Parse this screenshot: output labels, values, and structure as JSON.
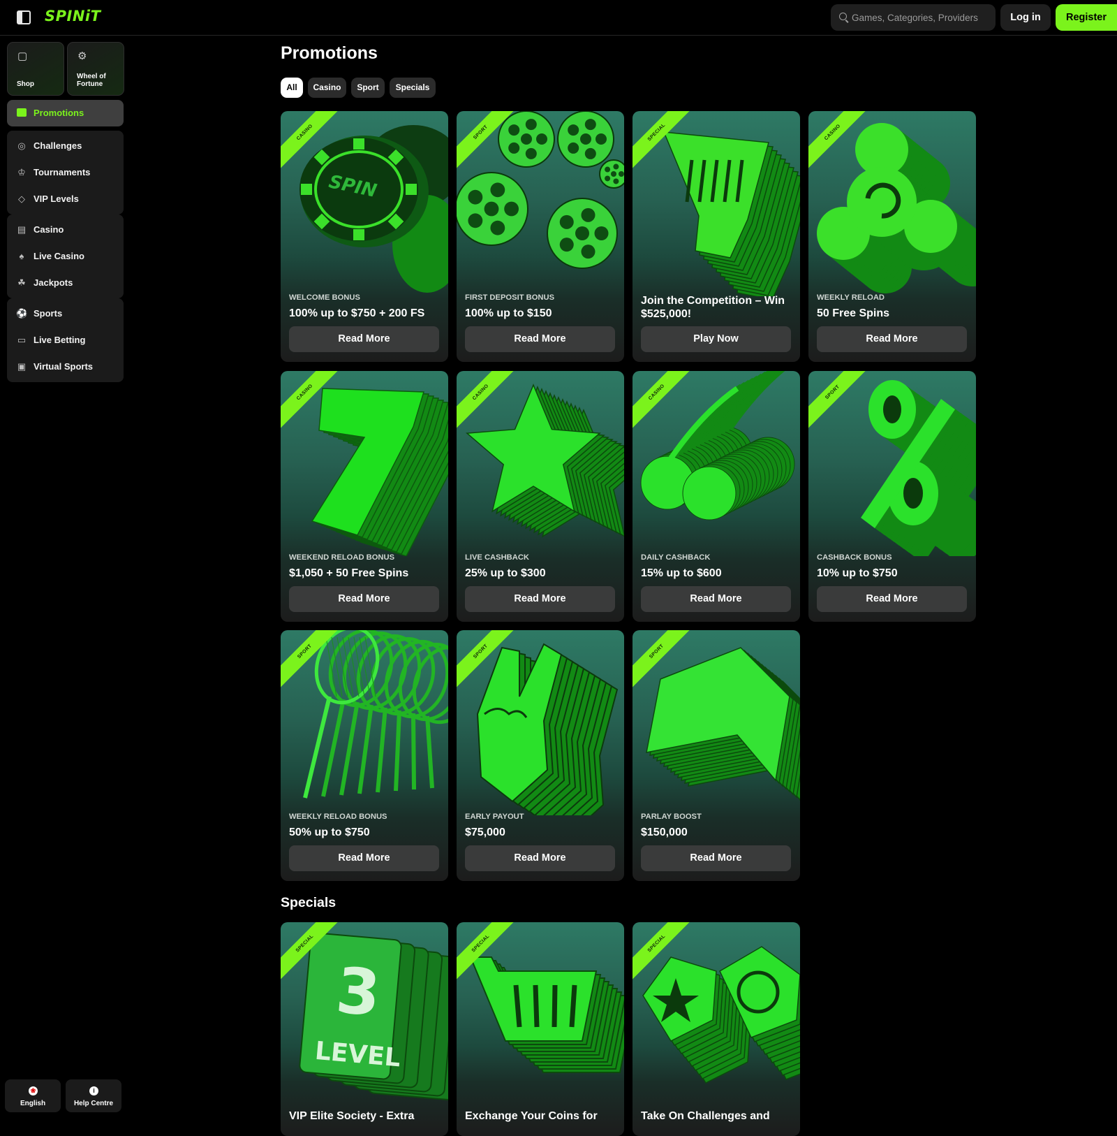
{
  "header": {
    "logo": "SPINiT",
    "search_placeholder": "Games, Categories, Providers",
    "login_label": "Log in",
    "register_label": "Register",
    "accent_color": "#7bf31c"
  },
  "sidebar": {
    "tiles": [
      {
        "label": "Shop",
        "icon": "shopping-bag-icon"
      },
      {
        "label": "Wheel of Fortune",
        "icon": "wheel-icon"
      }
    ],
    "active_item": {
      "label": "Promotions",
      "icon": "gift-icon"
    },
    "groups": [
      [
        {
          "label": "Challenges",
          "icon": "challenge-icon"
        },
        {
          "label": "Tournaments",
          "icon": "trophy-icon"
        },
        {
          "label": "VIP Levels",
          "icon": "diamond-icon"
        }
      ],
      [
        {
          "label": "Casino",
          "icon": "slot-machine-icon"
        },
        {
          "label": "Live Casino",
          "icon": "cards-icon"
        },
        {
          "label": "Jackpots",
          "icon": "clover-icon"
        }
      ],
      [
        {
          "label": "Sports",
          "icon": "soccer-ball-icon"
        },
        {
          "label": "Live Betting",
          "icon": "live-icon"
        },
        {
          "label": "Virtual Sports",
          "icon": "monitor-icon"
        }
      ]
    ],
    "footer": [
      {
        "label": "English",
        "icon": "canada-flag-icon"
      },
      {
        "label": "Help Centre",
        "icon": "info-icon"
      }
    ]
  },
  "main": {
    "title": "Promotions",
    "filters": [
      "All",
      "Casino",
      "Sport",
      "Specials"
    ],
    "active_filter": "All",
    "promotions": [
      {
        "tag": "CASINO",
        "subtitle": "WELCOME BONUS",
        "title": "100% up to $750 + 200 FS",
        "button": "Read More",
        "art": "casino-chips"
      },
      {
        "tag": "SPORT",
        "subtitle": "FIRST DEPOSIT BONUS",
        "title": "100% up to $150",
        "button": "Read More",
        "art": "soccer-balls"
      },
      {
        "tag": "SPECIAL",
        "subtitle": "",
        "title": "Join the Competition – Win $525,000!",
        "button": "Play Now",
        "art": "trophy"
      },
      {
        "tag": "CASINO",
        "subtitle": "WEEKLY RELOAD",
        "title": "50 Free Spins",
        "button": "Read More",
        "art": "spinner"
      },
      {
        "tag": "CASINO",
        "subtitle": "WEEKEND RELOAD BONUS",
        "title": "$1,050 + 50 Free Spins",
        "button": "Read More",
        "art": "lucky-seven"
      },
      {
        "tag": "CASINO",
        "subtitle": "LIVE CASHBACK",
        "title": "25% up to $300",
        "button": "Read More",
        "art": "star"
      },
      {
        "tag": "CASINO",
        "subtitle": "DAILY CASHBACK",
        "title": "15% up to $600",
        "button": "Read More",
        "art": "cherries"
      },
      {
        "tag": "SPORT",
        "subtitle": "CASHBACK BONUS",
        "title": "10% up to $750",
        "button": "Read More",
        "art": "percent"
      },
      {
        "tag": "SPORT",
        "subtitle": "WEEKLY RELOAD BONUS",
        "title": "50% up to $750",
        "button": "Read More",
        "art": "tennis-rackets"
      },
      {
        "tag": "SPORT",
        "subtitle": "EARLY PAYOUT",
        "title": "$75,000",
        "button": "Read More",
        "art": "foam-hand"
      },
      {
        "tag": "SPORT",
        "subtitle": "PARLAY BOOST",
        "title": "$150,000",
        "button": "Read More",
        "art": "arrow-up"
      }
    ],
    "specials_title": "Specials",
    "specials": [
      {
        "tag": "SPECIAL",
        "title": "VIP Elite Society - Extra",
        "art": "level-card",
        "art_text": [
          "3",
          "LEVEL"
        ]
      },
      {
        "tag": "SPECIAL",
        "title": "Exchange Your Coins for",
        "art": "shopping-cart"
      },
      {
        "tag": "SPECIAL",
        "title": "Take On Challenges and",
        "art": "badges"
      }
    ]
  }
}
